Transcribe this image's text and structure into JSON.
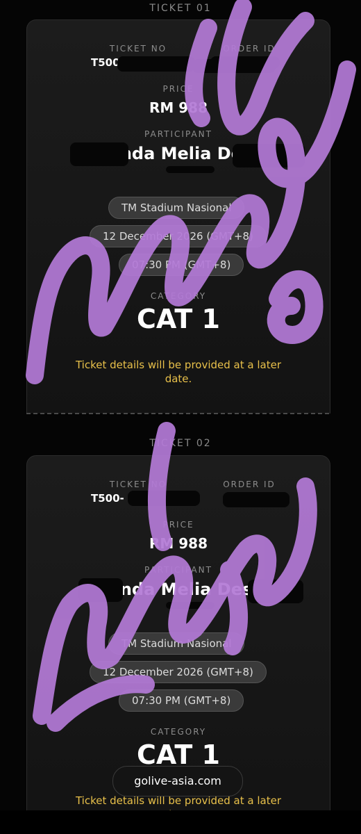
{
  "tickets": [
    {
      "heading": "TICKET 01",
      "ticket_no_label": "TICKET NO",
      "ticket_no_value": "T500",
      "order_id_label": "ORDER ID",
      "price_label": "PRICE",
      "price_value": "RM 988",
      "participant_label": "PARTICIPANT",
      "participant_value": "Wanda Melia Desti",
      "venue": "TM Stadium Nasional",
      "date": "12 December 2026 (GMT+8)",
      "time": "07:30 PM (GMT+8)",
      "category_label": "CATEGORY",
      "category_value": "CAT 1",
      "note": "Ticket details will be provided at a later date."
    },
    {
      "heading": "TICKET 02",
      "ticket_no_label": "TICKET NO",
      "ticket_no_value": "T500-",
      "order_id_label": "ORDER ID",
      "price_label": "PRICE",
      "price_value": "RM 988",
      "participant_label": "PARTICIPANT",
      "participant_value": "Wanda Melia Desti",
      "venue": "TM Stadium Nasional",
      "date": "12 December 2026 (GMT+8)",
      "time": "07:30 PM (GMT+8)",
      "category_label": "CATEGORY",
      "category_value": "CAT 1",
      "note": "Ticket details will be provided at a later date."
    }
  ],
  "floating_url": "golive-asia.com",
  "colors": {
    "background": "#050505",
    "card": "#181818",
    "note_yellow": "#e8c04a",
    "scribble_purple": "#b37ad6"
  }
}
